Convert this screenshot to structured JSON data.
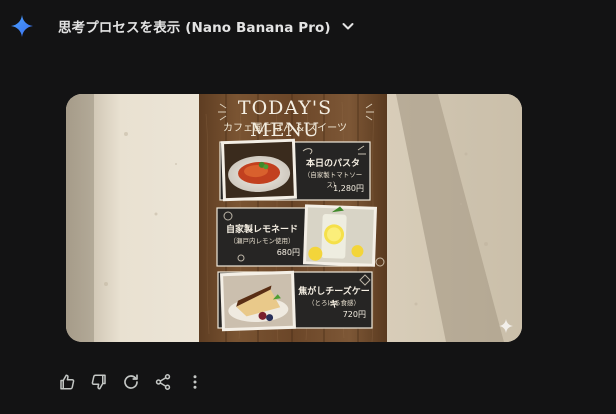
{
  "header": {
    "thinking_label": "思考プロセスを表示 (Nano Banana Pro)",
    "logo_icon": "gemini-spark-icon",
    "toggle_icon": "chevron-down-icon"
  },
  "menu_board": {
    "title": "TODAY'S MENU",
    "subtitle": "カフェ風ごはん & スイーツ",
    "items": [
      {
        "name": "本日のパスタ",
        "note": "（自家製トマトソース）",
        "price": "1,280円"
      },
      {
        "name": "自家製レモネード",
        "note": "（瀬戸内レモン使用）",
        "price": "680円"
      },
      {
        "name": "焦がしチーズケーキ",
        "note": "（とろける食感）",
        "price": "720円"
      }
    ]
  },
  "toolbar": {
    "icons": [
      "thumbs-up-icon",
      "thumbs-down-icon",
      "regenerate-icon",
      "share-icon",
      "more-options-icon"
    ]
  },
  "colors": {
    "background": "#131314",
    "text": "#e3e3e3",
    "accent_spark": "#4a8df8"
  }
}
